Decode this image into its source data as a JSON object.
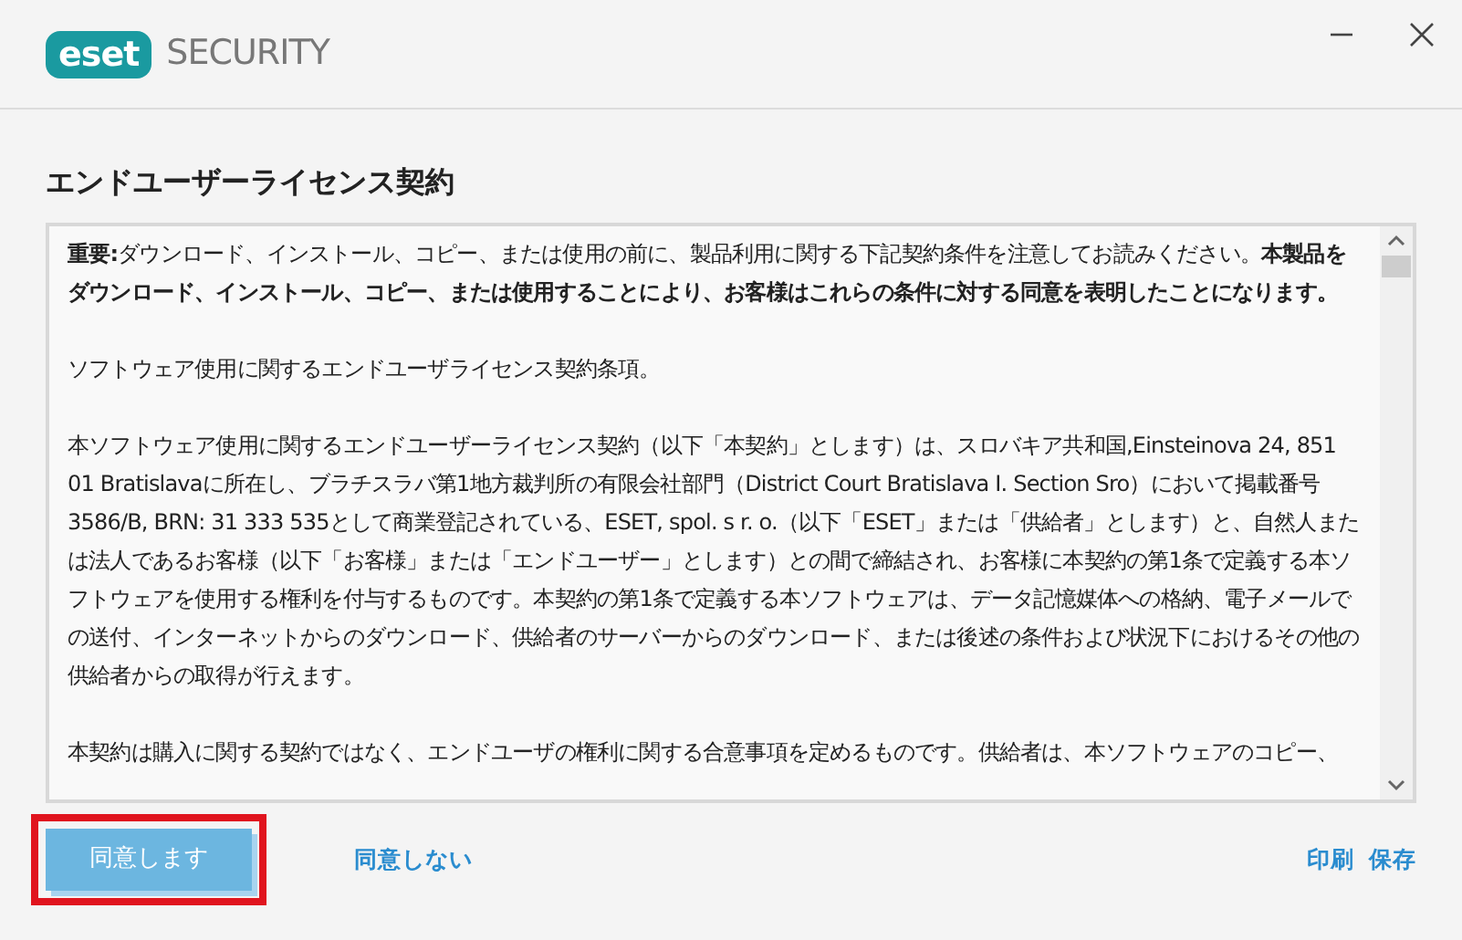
{
  "header": {
    "logo": "eset",
    "product": "SECURITY"
  },
  "title": "エンドユーザーライセンス契約",
  "license_text": {
    "paragraphs": [
      "**重要:**ダウンロード、インストール、コピー、または使用の前に、製品利用に関する下記契約条件を注意してお読みください。**本製品をダウンロード、インストール、コピー、または使用することにより、お客様はこれらの条件に対する同意を表明したことになります。**",
      "ソフトウェア使用に関するエンドユーザライセンス契約条項。",
      "本ソフトウェア使用に関するエンドユーザーライセンス契約（以下「本契約」とします）は、スロバキア共和国,Einsteinova 24, 851 01 Bratislavaに所在し、ブラチスラバ第1地方裁判所の有限会社部門（District Court Bratislava I. Section Sro）において掲載番号3586/B, BRN: 31 333 535として商業登記されている、ESET, spol. s r. o.（以下「ESET」または「供給者」とします）と、自然人または法人であるお客様（以下「お客様」または「エンドユーザー」とします）との間で締結され、お客様に本契約の第1条で定義する本ソフトウェアを使用する権利を付与するものです。本契約の第1条で定義する本ソフトウェアは、データ記憶媒体への格納、電子メールでの送付、インターネットからのダウンロード、供給者のサーバーからのダウンロード、または後述の条件および状況下におけるその他の供給者からの取得が行えます。",
      "本契約は購入に関する契約ではなく、エンドユーザの権利に関する合意事項を定めるものです。供給者は、本ソフトウェアのコピー、"
    ]
  },
  "buttons": [
    {
      "label": "同意します",
      "kind": "primary",
      "highlighted": true
    },
    {
      "label": "同意しない",
      "kind": "link"
    }
  ],
  "actions": [
    "印刷",
    "保存"
  ]
}
